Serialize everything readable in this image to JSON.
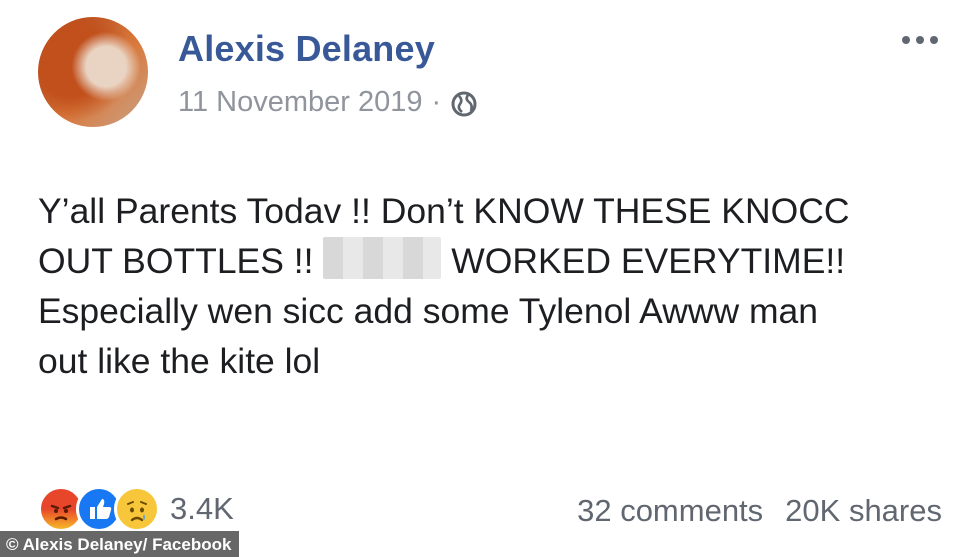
{
  "post": {
    "author": "Alexis Delaney",
    "date": "11 November 2019",
    "separator": "·",
    "privacy_icon": "globe-icon",
    "more_icon": "more-options-icon",
    "text_lines": [
      "Y’all Parents Todav !! Don’t KNOW THESE KNOCC",
      [
        "OUT BOTTLES !! ",
        "WORKED EVERYTIME!!"
      ],
      "Especially wen sicc add some Tylenol Awww man",
      "out like the kite lol"
    ]
  },
  "reactions": {
    "icons": [
      "angry-icon",
      "like-icon",
      "sad-icon"
    ],
    "count": "3.4K"
  },
  "stats": {
    "comments": "32 comments",
    "shares": "20K shares"
  },
  "credit": "© Alexis Delaney/ Facebook",
  "colors": {
    "author": "#385898",
    "meta": "#90949c",
    "like": "#1877f2"
  }
}
